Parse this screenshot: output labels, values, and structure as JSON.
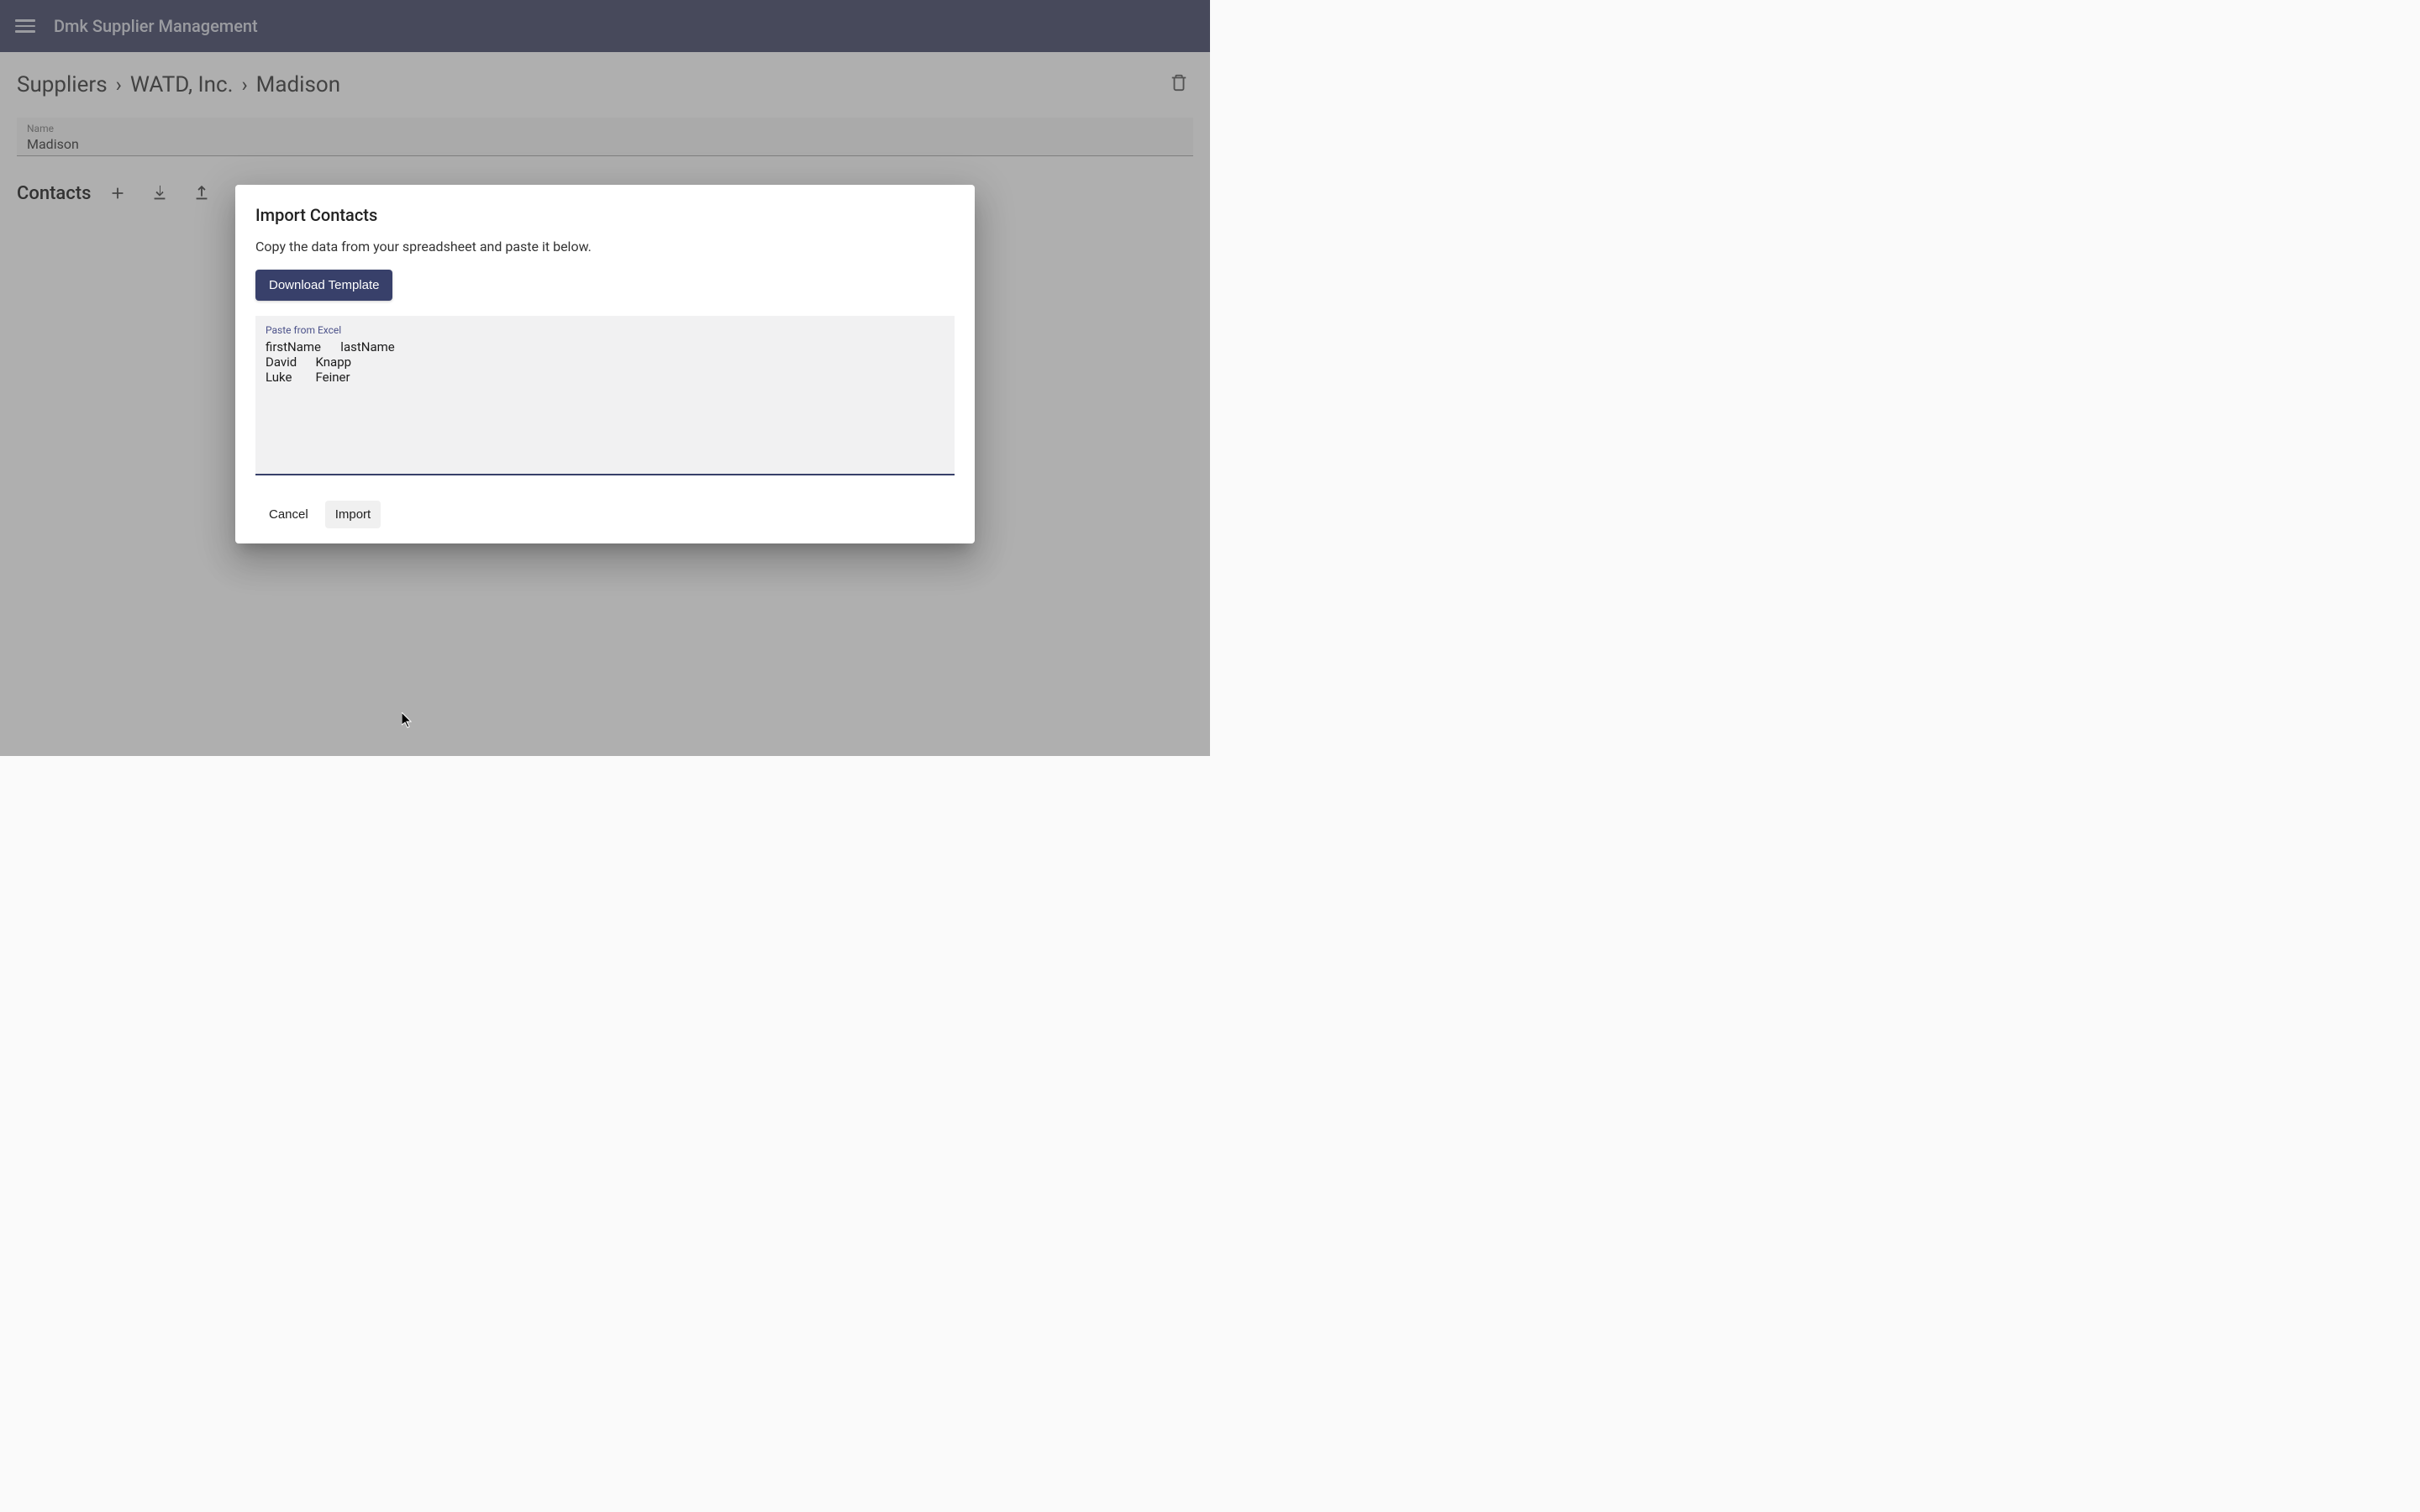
{
  "header": {
    "app_title": "Dmk Supplier Management"
  },
  "breadcrumb": {
    "items": [
      "Suppliers",
      "WATD, Inc.",
      "Madison"
    ]
  },
  "name_field": {
    "label": "Name",
    "value": "Madison"
  },
  "contacts": {
    "title": "Contacts"
  },
  "dialog": {
    "title": "Import Contacts",
    "description": "Copy the data from your spreadsheet and paste it below.",
    "download_label": "Download Template",
    "paste_label": "Paste from Excel",
    "paste_value": "firstName\tlastName\nDavid\tKnapp\nLuke\tFeiner",
    "cancel_label": "Cancel",
    "import_label": "Import"
  }
}
